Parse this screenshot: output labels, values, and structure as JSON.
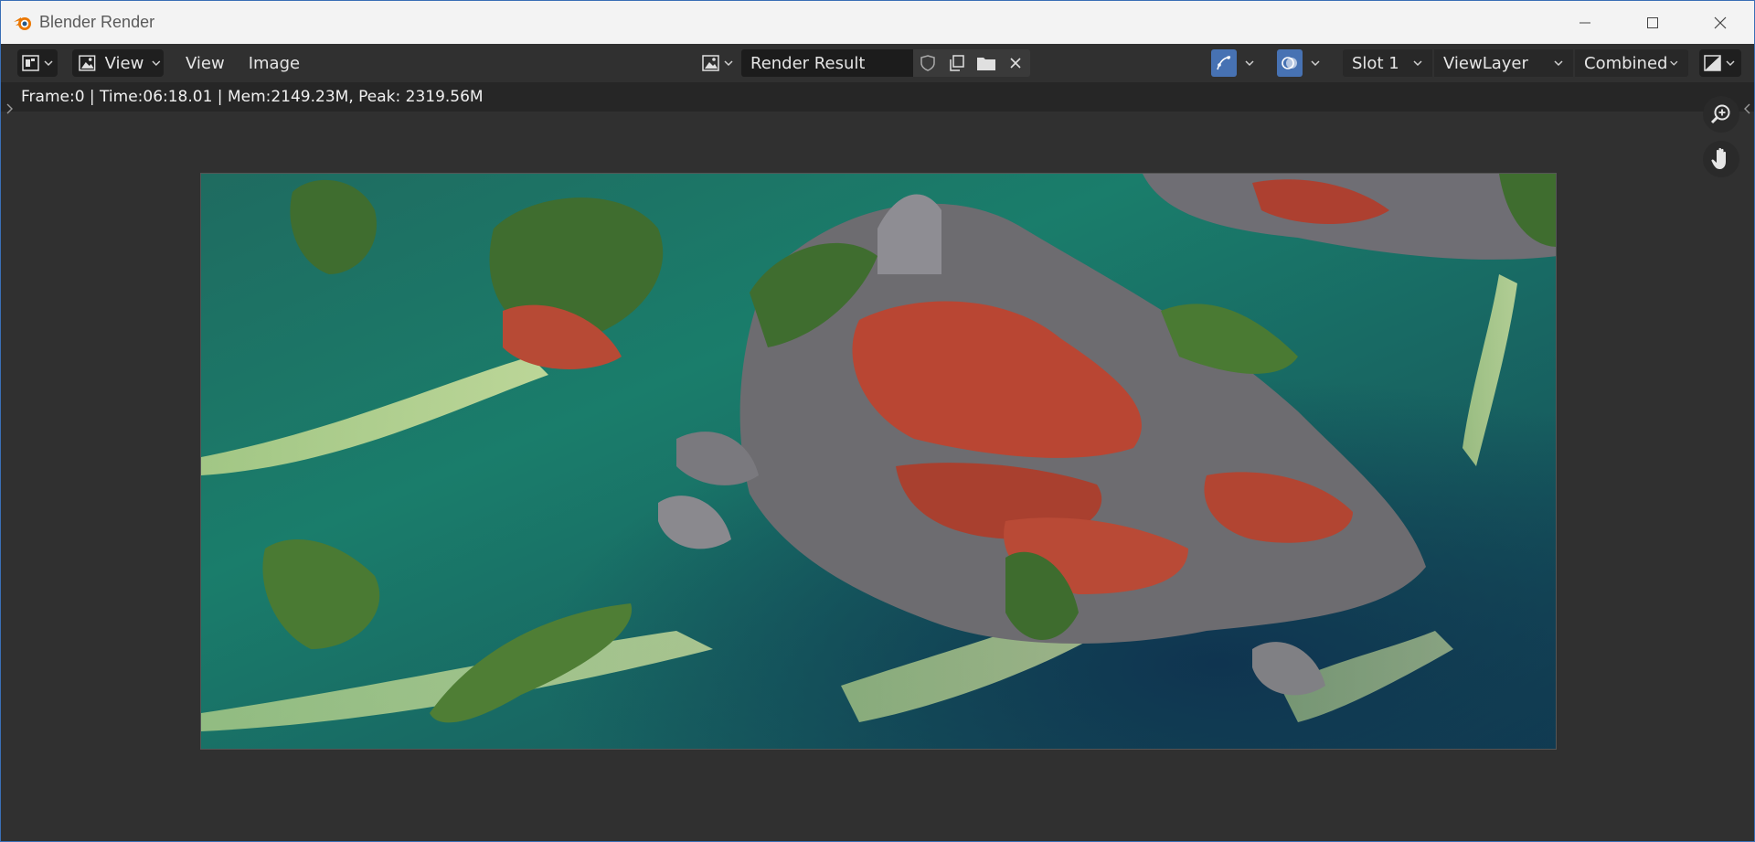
{
  "window": {
    "title": "Blender Render",
    "buttons": [
      "minimize",
      "maximize",
      "close"
    ]
  },
  "header": {
    "view_dropdown_label": "View",
    "menus": [
      "View",
      "Image"
    ],
    "image_name": "Render Result",
    "slot": "Slot 1",
    "view_layer": "ViewLayer",
    "pass": "Combined"
  },
  "info": {
    "stats": "Frame:0 | Time:06:18.01 | Mem:2149.23M, Peak: 2319.56M"
  },
  "colors": {
    "accent": "#4772b3",
    "blender_orange": "#ea7600"
  },
  "icons": {
    "editor_type": "image-editor-icon",
    "zoom": "zoom-in-icon",
    "pan": "hand-icon"
  }
}
